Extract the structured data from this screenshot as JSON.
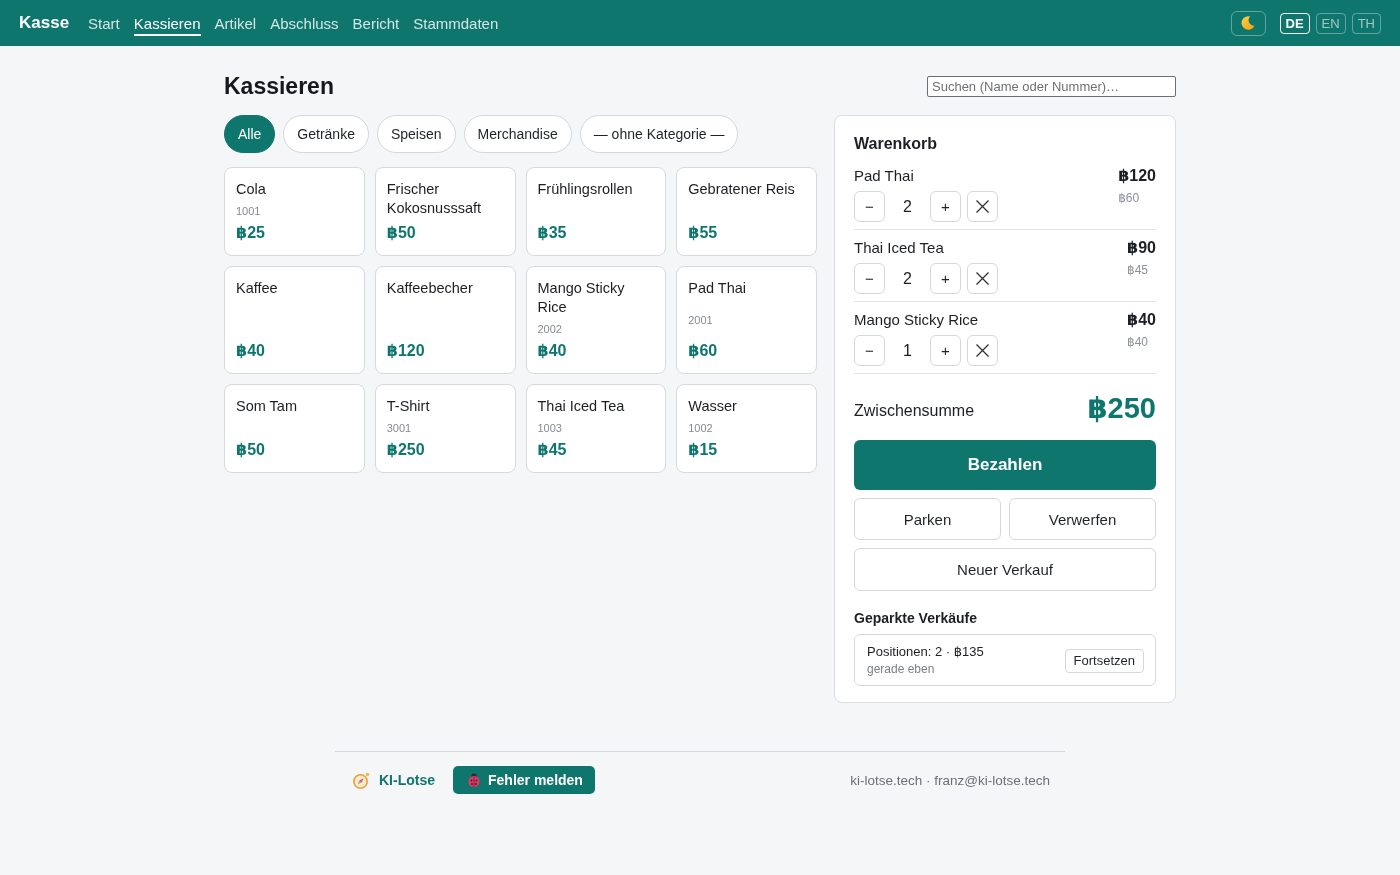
{
  "header": {
    "brand": "Kasse",
    "nav": [
      {
        "label": "Start",
        "selected": false
      },
      {
        "label": "Kassieren",
        "selected": true
      },
      {
        "label": "Artikel",
        "selected": false
      },
      {
        "label": "Abschluss",
        "selected": false
      },
      {
        "label": "Bericht",
        "selected": false
      },
      {
        "label": "Stammdaten",
        "selected": false
      }
    ],
    "languages": [
      {
        "label": "DE",
        "selected": true
      },
      {
        "label": "EN",
        "selected": false
      },
      {
        "label": "TH",
        "selected": false
      }
    ]
  },
  "title": "Kassieren",
  "search": {
    "placeholder": "Suchen (Name oder Nummer)…"
  },
  "categories": [
    {
      "label": "Alle",
      "selected": true
    },
    {
      "label": "Getränke",
      "selected": false
    },
    {
      "label": "Speisen",
      "selected": false
    },
    {
      "label": "Merchandise",
      "selected": false
    },
    {
      "label": "— ohne Kategorie —",
      "selected": false
    }
  ],
  "products": [
    {
      "name": "Cola",
      "number": "1001",
      "price": "฿25"
    },
    {
      "name": "Frischer Kokosnusssaft",
      "price": "฿50"
    },
    {
      "name": "Frühlingsrollen",
      "price": "฿35"
    },
    {
      "name": "Gebratener Reis",
      "price": "฿55"
    },
    {
      "name": "Kaffee",
      "price": "฿40"
    },
    {
      "name": "Kaffeebecher",
      "price": "฿120"
    },
    {
      "name": "Mango Sticky Rice",
      "number": "2002",
      "price": "฿40"
    },
    {
      "name": "Pad Thai",
      "number": "2001",
      "price": "฿60"
    },
    {
      "name": "Som Tam",
      "price": "฿50"
    },
    {
      "name": "T-Shirt",
      "number": "3001",
      "price": "฿250"
    },
    {
      "name": "Thai Iced Tea",
      "number": "1003",
      "price": "฿45"
    },
    {
      "name": "Wasser",
      "number": "1002",
      "price": "฿15"
    }
  ],
  "cart": {
    "title": "Warenkorb",
    "items": [
      {
        "name": "Pad Thai",
        "minus": "−",
        "quantity": "2",
        "plus": "+",
        "total": "฿120",
        "unit_price": "฿60"
      },
      {
        "name": "Thai Iced Tea",
        "minus": "−",
        "quantity": "2",
        "plus": "+",
        "total": "฿90",
        "unit_price": "฿45"
      },
      {
        "name": "Mango Sticky Rice",
        "minus": "−",
        "quantity": "1",
        "plus": "+",
        "total": "฿40",
        "unit_price": "฿40"
      }
    ],
    "subtotal": {
      "label": "Zwischensumme",
      "amount": "฿250"
    },
    "pay": "Bezahlen",
    "park": "Parken",
    "discard": "Verwerfen",
    "new_sale": "Neuer Verkauf",
    "parked": {
      "title": "Geparkte Verkäufe",
      "sales": [
        {
          "summary": "Positionen: 2 · ฿135",
          "time": "gerade eben",
          "resume": "Fortsetzen"
        }
      ]
    }
  },
  "footer": {
    "brand": "KI-Lotse",
    "report": "Fehler melden",
    "contact": "ki-lotse.tech · franz@ki-lotse.tech"
  }
}
